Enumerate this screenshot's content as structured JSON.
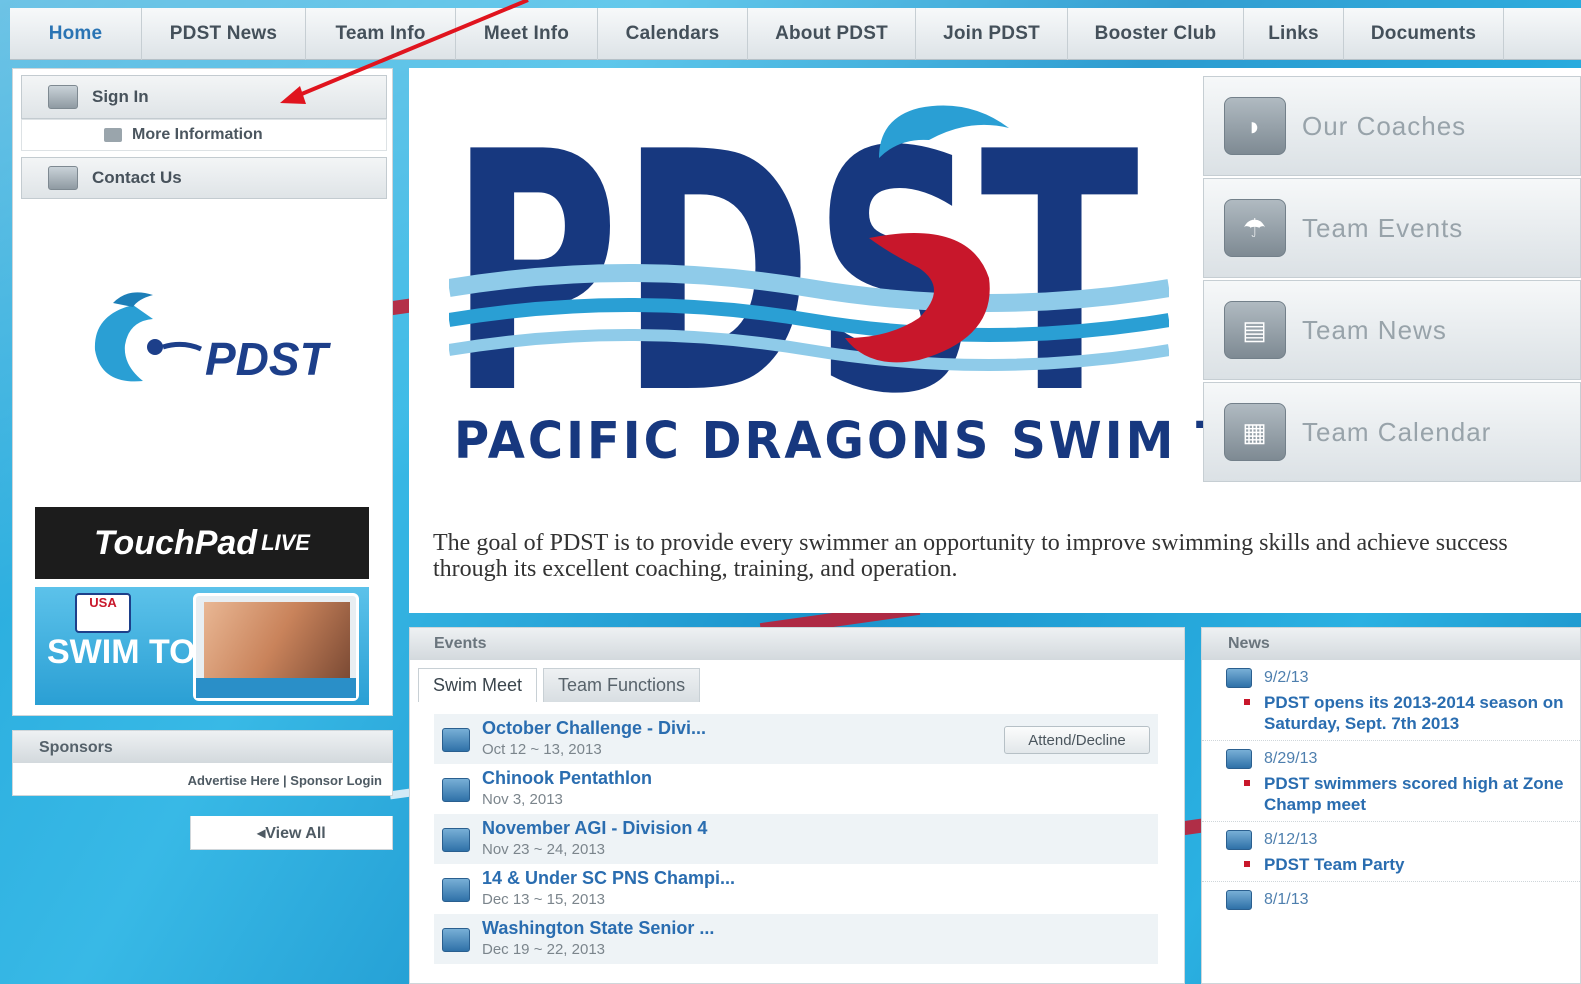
{
  "nav": [
    "Home",
    "PDST News",
    "Team Info",
    "Meet Info",
    "Calendars",
    "About PDST",
    "Join PDST",
    "Booster Club",
    "Links",
    "Documents"
  ],
  "sidebar": {
    "sign_in": "Sign In",
    "more_info": "More Information",
    "contact": "Contact Us"
  },
  "ads": {
    "touchpad": "TouchPad",
    "touchpad_live": "LIVE",
    "usa_badge": "USA",
    "swim_today": "SWIM TODAY"
  },
  "sponsors": {
    "title": "Sponsors",
    "links": "Advertise Here | Sponsor Login",
    "view_all": "◂View All"
  },
  "main": {
    "logo_text": "PDST",
    "team_name": "PACIFIC DRAGONS SWIM TEAM",
    "goal": "The goal of PDST is to provide every swimmer an opportunity to improve swimming skills and achieve success through its excellent coaching, training, and operation."
  },
  "quick_links": [
    "Our Coaches",
    "Team Events",
    "Team News",
    "Team Calendar"
  ],
  "events": {
    "title": "Events",
    "tabs": [
      "Swim Meet",
      "Team Functions"
    ],
    "attend": "Attend/Decline",
    "items": [
      {
        "title": "October Challenge - Divi...",
        "date": "Oct 12 ~ 13, 2013"
      },
      {
        "title": "Chinook Pentathlon",
        "date": "Nov 3, 2013"
      },
      {
        "title": "November AGI - Division 4",
        "date": "Nov 23 ~ 24, 2013"
      },
      {
        "title": "14 & Under SC PNS Champi...",
        "date": "Dec 13 ~ 15, 2013"
      },
      {
        "title": "Washington State Senior ...",
        "date": "Dec 19 ~ 22, 2013"
      }
    ]
  },
  "news": {
    "title": "News",
    "items": [
      {
        "date": "9/2/13",
        "text": "PDST opens its 2013-2014 season on Saturday, Sept. 7th 2013"
      },
      {
        "date": "8/29/13",
        "text": "PDST swimmers scored high at Zone Champ meet"
      },
      {
        "date": "8/12/13",
        "text": "PDST Team Party"
      },
      {
        "date": "8/1/13",
        "text": ""
      }
    ]
  },
  "colors": {
    "accent": "#2a6db0",
    "brand_navy": "#17387f",
    "pool": "#1fa3d8",
    "lane_red": "#c8172b"
  }
}
